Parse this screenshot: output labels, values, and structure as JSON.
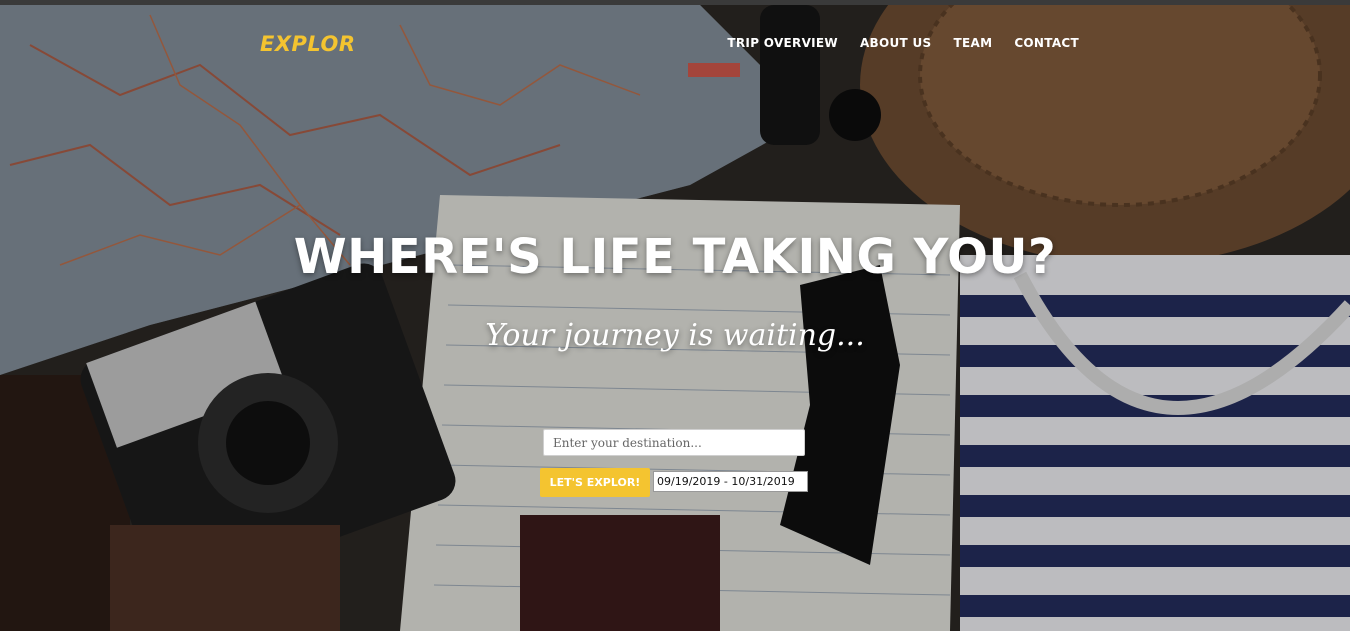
{
  "nav": {
    "brand": "EXPLOR",
    "links": [
      {
        "label": "TRIP OVERVIEW"
      },
      {
        "label": "ABOUT US"
      },
      {
        "label": "TEAM"
      },
      {
        "label": "CONTACT"
      }
    ]
  },
  "hero": {
    "headline": "WHERE'S LIFE TAKING YOU?",
    "tagline": "Your journey is waiting...",
    "destination_placeholder": "Enter your destination...",
    "destination_value": "",
    "button_label": "LET'S EXPLOR!",
    "date_range_value": "09/19/2019 - 10/31/2019"
  },
  "colors": {
    "accent": "#f4c430",
    "text": "#ffffff"
  }
}
